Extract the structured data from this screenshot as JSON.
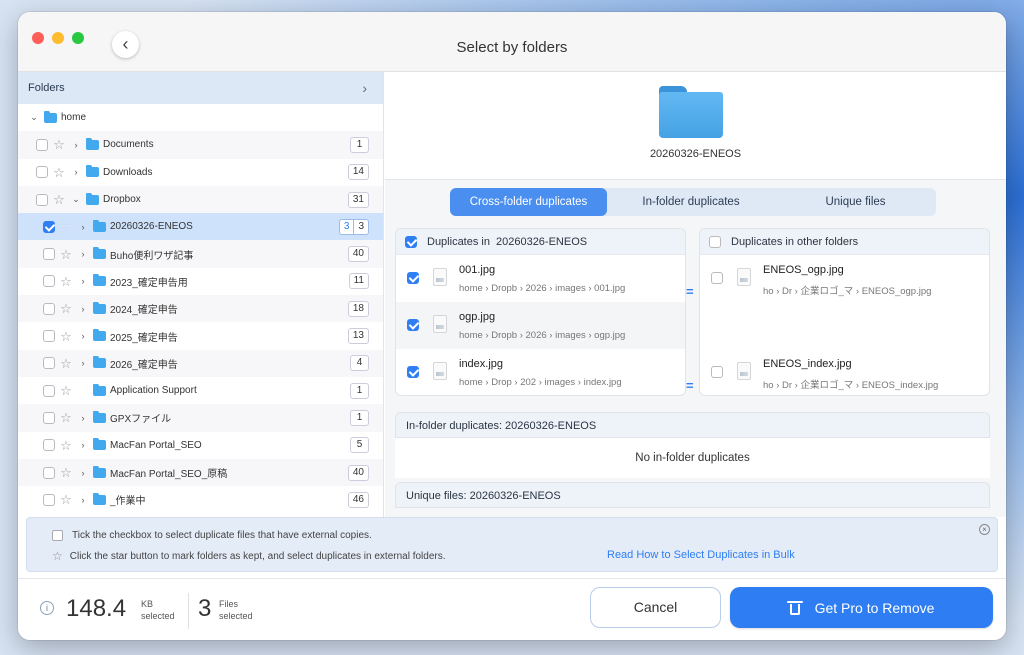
{
  "window": {
    "title": "Select by folders"
  },
  "sidebar": {
    "header": "Folders",
    "root": "home",
    "items": [
      {
        "name": "Documents",
        "count": "1",
        "indent": 1,
        "expanded": false,
        "checked": false
      },
      {
        "name": "Downloads",
        "count": "14",
        "indent": 1,
        "expanded": false,
        "checked": false
      },
      {
        "name": "Dropbox",
        "count": "31",
        "indent": 1,
        "expanded": true,
        "checked": false
      },
      {
        "name": "20260326-ENEOS",
        "count_selected": "3",
        "count": "3",
        "indent": 2,
        "expanded": false,
        "checked": true,
        "selected": true
      },
      {
        "name": "Buho便利ワザ記事",
        "count": "40",
        "indent": 2,
        "expanded": false,
        "checked": false
      },
      {
        "name": "2023_確定申告用",
        "count": "11",
        "indent": 2,
        "expanded": false,
        "checked": false
      },
      {
        "name": "2024_確定申告",
        "count": "18",
        "indent": 2,
        "expanded": false,
        "checked": false
      },
      {
        "name": "2025_確定申告",
        "count": "13",
        "indent": 2,
        "expanded": false,
        "checked": false
      },
      {
        "name": "2026_確定申告",
        "count": "4",
        "indent": 2,
        "expanded": false,
        "checked": false
      },
      {
        "name": "Application Support",
        "count": "1",
        "indent": 2,
        "expanded": false,
        "checked": false,
        "nochevron": true
      },
      {
        "name": "GPXファイル",
        "count": "1",
        "indent": 2,
        "expanded": false,
        "checked": false
      },
      {
        "name": "MacFan Portal_SEO",
        "count": "5",
        "indent": 2,
        "expanded": false,
        "checked": false
      },
      {
        "name": "MacFan Portal_SEO_原稿",
        "count": "40",
        "indent": 2,
        "expanded": false,
        "checked": false
      },
      {
        "name": "_作業中",
        "count": "46",
        "indent": 2,
        "expanded": false,
        "checked": false
      }
    ]
  },
  "detail": {
    "folder_name": "20260326-ENEOS",
    "tabs": [
      {
        "label": "Cross-folder duplicates",
        "active": true
      },
      {
        "label": "In-folder duplicates",
        "active": false
      },
      {
        "label": "Unique files",
        "active": false
      }
    ],
    "left_panel": {
      "header_prefix": "Duplicates in",
      "header_folder": "20260326-ENEOS",
      "files": [
        {
          "name": "001.jpg",
          "path": "home  ›  Dropb  ›  2026  ›  images  ›  001.jpg"
        },
        {
          "name": "ogp.jpg",
          "path": "home  ›  Dropb  ›  2026  ›  images  ›  ogp.jpg"
        },
        {
          "name": "index.jpg",
          "path": "home  ›  Drop  ›  202  ›  images  ›  index.jpg"
        }
      ]
    },
    "right_panel": {
      "header": "Duplicates in other folders",
      "files": [
        {
          "name": "ENEOS_ogp.jpg",
          "path": "ho  ›  Dr  ›  企業ロゴ_マ  ›  ENEOS_ogp.jpg"
        },
        {
          "name": "ENEOS_index.jpg",
          "path": "ho  ›  Dr  ›  企業ロゴ_マ  ›  ENEOS_index.jpg"
        }
      ]
    },
    "equals_symbol": "=",
    "in_folder": {
      "header": "In-folder duplicates:  20260326-ENEOS",
      "empty_message": "No in-folder duplicates"
    },
    "unique": {
      "header": "Unique files:  20260326-ENEOS"
    }
  },
  "tips": {
    "checkbox_tip": "Tick the checkbox to select duplicate files that have external copies.",
    "star_tip": "Click the star button to mark folders as kept, and select duplicates in external folders.",
    "link": "Read How to Select Duplicates in Bulk"
  },
  "footer": {
    "size_value": "148.4",
    "size_unit": "KB",
    "size_label": "selected",
    "files_value": "3",
    "files_unit": "Files",
    "files_label": "selected",
    "cancel_label": "Cancel",
    "pro_label": "Get Pro to Remove"
  },
  "colors": {
    "accent": "#2e7df2",
    "selection": "#cfe2fb",
    "folder": "#42a9ee"
  }
}
